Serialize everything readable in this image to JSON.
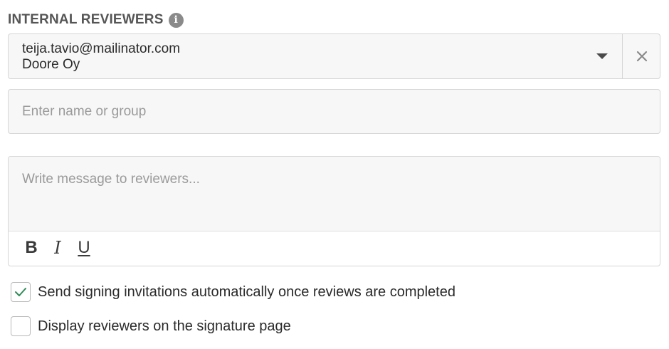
{
  "section": {
    "title": "INTERNAL REVIEWERS",
    "info_icon": "info-icon"
  },
  "reviewer": {
    "email": "teija.tavio@mailinator.com",
    "company": "Doore Oy",
    "caret_icon": "chevron-down-icon",
    "remove_icon": "close-icon"
  },
  "name_input": {
    "placeholder": "Enter name or group",
    "value": ""
  },
  "message": {
    "placeholder": "Write message to reviewers...",
    "value": "",
    "toolbar": {
      "bold": "B",
      "italic": "I",
      "underline": "U"
    }
  },
  "options": [
    {
      "label": "Send signing invitations automatically once reviews are completed",
      "checked": true
    },
    {
      "label": "Display reviewers on the signature page",
      "checked": false
    }
  ],
  "colors": {
    "check": "#2e8b57",
    "field_bg": "#f7f7f7",
    "border": "#d6d6d6"
  }
}
